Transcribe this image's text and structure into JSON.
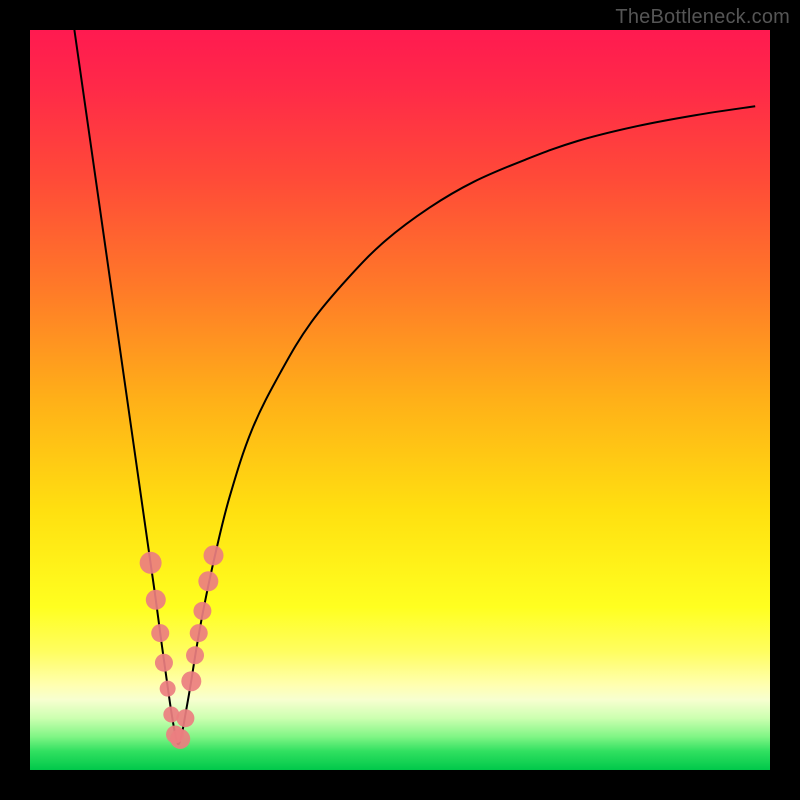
{
  "watermark": "TheBottleneck.com",
  "colors": {
    "frame": "#000000",
    "curve": "#000000",
    "marker_fill": "#ec7e80",
    "marker_stroke": "#c25a5c",
    "gradient_stops": [
      {
        "offset": 0.0,
        "color": "#ff1a50"
      },
      {
        "offset": 0.08,
        "color": "#ff2a48"
      },
      {
        "offset": 0.2,
        "color": "#ff4a38"
      },
      {
        "offset": 0.35,
        "color": "#ff7a28"
      },
      {
        "offset": 0.5,
        "color": "#ffb018"
      },
      {
        "offset": 0.65,
        "color": "#ffe010"
      },
      {
        "offset": 0.78,
        "color": "#ffff20"
      },
      {
        "offset": 0.84,
        "color": "#fffe60"
      },
      {
        "offset": 0.885,
        "color": "#ffffb0"
      },
      {
        "offset": 0.905,
        "color": "#f7ffd0"
      },
      {
        "offset": 0.93,
        "color": "#ccffb0"
      },
      {
        "offset": 0.955,
        "color": "#80f585"
      },
      {
        "offset": 0.975,
        "color": "#30e060"
      },
      {
        "offset": 1.0,
        "color": "#00c84a"
      }
    ]
  },
  "chart_data": {
    "type": "line",
    "title": "",
    "xlabel": "",
    "ylabel": "",
    "x_range": [
      0,
      100
    ],
    "y_range": [
      0,
      100
    ],
    "optimal_x": 20,
    "series": [
      {
        "name": "bottleneck-curve",
        "x": [
          6,
          8,
          10,
          12,
          14,
          15,
          16,
          17,
          17.8,
          18.5,
          19,
          19.5,
          20,
          20.5,
          21,
          21.7,
          22.5,
          23.5,
          25,
          27,
          30,
          34,
          38,
          43,
          48,
          54,
          60,
          67,
          74,
          82,
          90,
          98
        ],
        "y": [
          100,
          86,
          72,
          58,
          44,
          37,
          30,
          23,
          17,
          12,
          8.5,
          5.5,
          3.5,
          4.8,
          7.5,
          11.5,
          16.5,
          22,
          29,
          37,
          46,
          54,
          60.5,
          66.5,
          71.5,
          76,
          79.5,
          82.5,
          85,
          87,
          88.5,
          89.7
        ]
      }
    ],
    "markers": {
      "name": "sample-points",
      "points": [
        {
          "x": 16.3,
          "y": 28,
          "r": 11
        },
        {
          "x": 17.0,
          "y": 23,
          "r": 10
        },
        {
          "x": 17.6,
          "y": 18.5,
          "r": 9
        },
        {
          "x": 18.1,
          "y": 14.5,
          "r": 9
        },
        {
          "x": 18.6,
          "y": 11,
          "r": 8
        },
        {
          "x": 19.1,
          "y": 7.5,
          "r": 8
        },
        {
          "x": 19.6,
          "y": 4.8,
          "r": 9
        },
        {
          "x": 20.3,
          "y": 4.2,
          "r": 10
        },
        {
          "x": 21.0,
          "y": 7.0,
          "r": 9
        },
        {
          "x": 21.8,
          "y": 12.0,
          "r": 10
        },
        {
          "x": 22.3,
          "y": 15.5,
          "r": 9
        },
        {
          "x": 22.8,
          "y": 18.5,
          "r": 9
        },
        {
          "x": 23.3,
          "y": 21.5,
          "r": 9
        },
        {
          "x": 24.1,
          "y": 25.5,
          "r": 10
        },
        {
          "x": 24.8,
          "y": 29.0,
          "r": 10
        }
      ]
    }
  }
}
